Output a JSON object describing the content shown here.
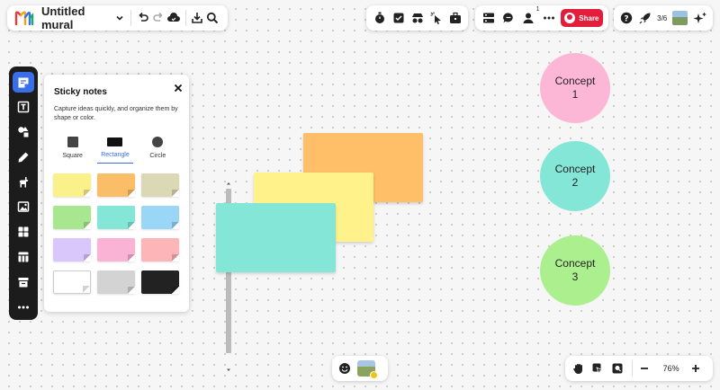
{
  "header": {
    "mural_title": "Untitled mural"
  },
  "collab": {
    "member_count": "1",
    "share_label": "Share"
  },
  "top_right": {
    "progress": "3/6"
  },
  "sticky_panel": {
    "title": "Sticky notes",
    "description": "Capture ideas quickly, and organize them by shape or color.",
    "shapes": [
      {
        "label": "Square",
        "selected": false
      },
      {
        "label": "Rectangle",
        "selected": true
      },
      {
        "label": "Circle",
        "selected": false
      }
    ],
    "colors": [
      "#fbf18b",
      "#fbbe68",
      "#dbd9b5",
      "#a8e68f",
      "#84e6d7",
      "#9ad6f6",
      "#d9c6fb",
      "#fab3d4",
      "#fdb5b8",
      "#ffffff",
      "#d3d3d3",
      "#222222"
    ]
  },
  "canvas": {
    "notes": [
      {
        "color": "#ffbe68"
      },
      {
        "color": "#fff28b"
      },
      {
        "color": "#84e6d7"
      }
    ],
    "concepts": [
      {
        "label": "Concept\n1",
        "color": "#fdb7d6"
      },
      {
        "label": "Concept\n2",
        "color": "#84e6d7"
      },
      {
        "label": "Concept\n3",
        "color": "#abef8f"
      }
    ]
  },
  "zoom": {
    "level": "76%"
  },
  "colors": {
    "accent": "#3a6ee8",
    "share": "#e21e3a",
    "toolbar": "#1c1c1c"
  }
}
